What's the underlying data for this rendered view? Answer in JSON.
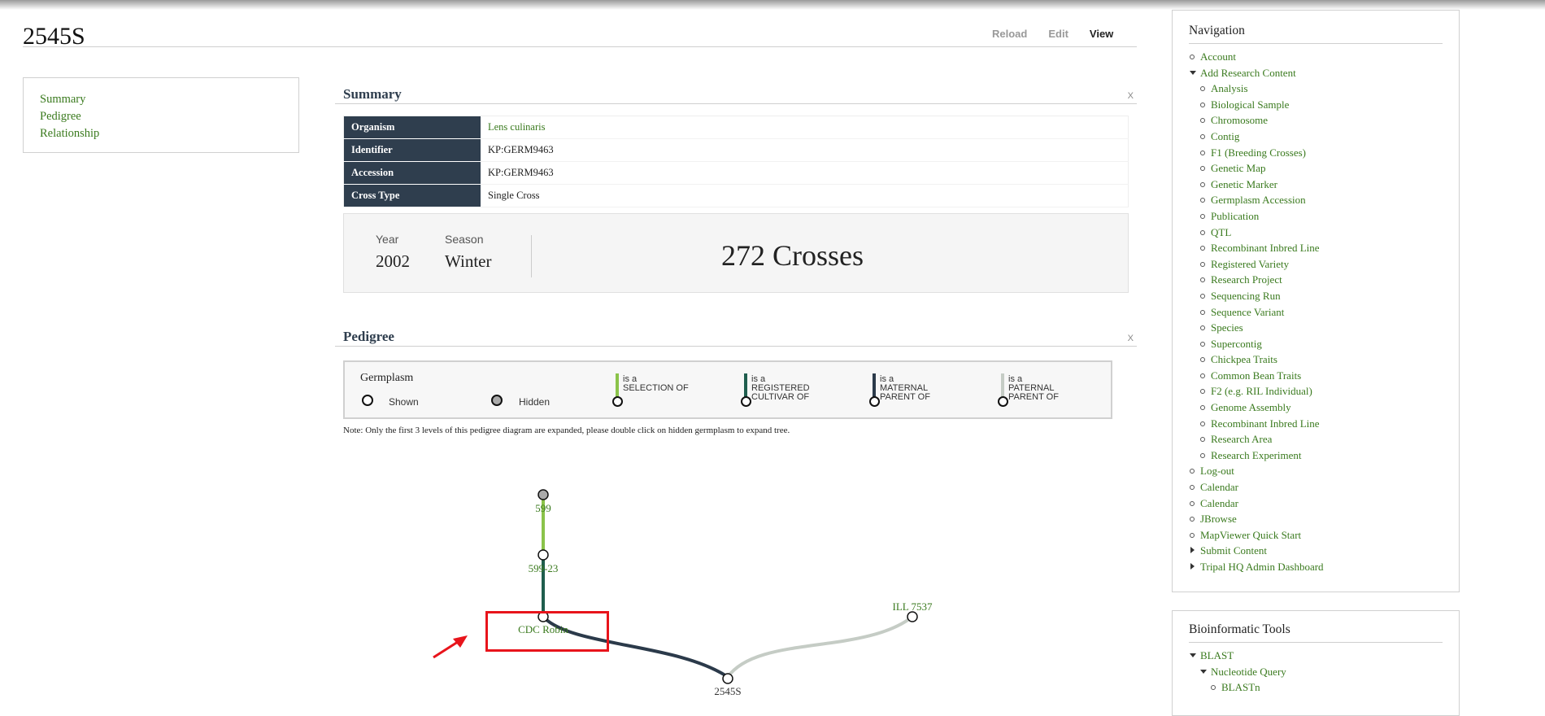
{
  "page": {
    "title": "2545S"
  },
  "tabs": [
    {
      "label": "Reload"
    },
    {
      "label": "Edit"
    },
    {
      "label": "View"
    }
  ],
  "toc": [
    "Summary",
    "Pedigree",
    "Relationship"
  ],
  "summary": {
    "heading": "Summary",
    "close": "X",
    "rows": [
      {
        "key": "Organism",
        "value": "Lens culinaris"
      },
      {
        "key": "Identifier",
        "value": "KP:GERM9463"
      },
      {
        "key": "Accession",
        "value": "KP:GERM9463"
      },
      {
        "key": "Cross Type",
        "value": "Single Cross"
      }
    ],
    "year_label": "Year",
    "year": "2002",
    "season_label": "Season",
    "season": "Winter",
    "crosses": "272 Crosses"
  },
  "pedigree": {
    "heading": "Pedigree",
    "close": "X",
    "legend_title": "Germplasm",
    "shown": "Shown",
    "hidden": "Hidden",
    "relations": [
      {
        "is": "is a",
        "text": [
          "SELECTION OF"
        ],
        "color": "#8bc34a"
      },
      {
        "is": "is a",
        "text": [
          "REGISTERED",
          "CULTIVAR OF"
        ],
        "color": "#1f5e4e"
      },
      {
        "is": "is a",
        "text": [
          "MATERNAL",
          "PARENT OF"
        ],
        "color": "#2b3a4a"
      },
      {
        "is": "is a",
        "text": [
          "PATERNAL",
          "PARENT OF"
        ],
        "color": "#c5ccc5"
      }
    ],
    "note": "Note: Only the first 3 levels of this pedigree diagram are expanded, please double click on hidden germplasm to expand tree.",
    "nodes": {
      "n599": "599",
      "n59923": "599-23",
      "cdc": "CDC Robin",
      "ill": "ILL 7537",
      "root": "2545S"
    }
  },
  "navigation": {
    "title": "Navigation",
    "items": [
      {
        "label": "Account",
        "level": 0,
        "marker": "bullet"
      },
      {
        "label": "Add Research Content",
        "level": 0,
        "marker": "down"
      },
      {
        "label": "Analysis",
        "level": 1,
        "marker": "bullet"
      },
      {
        "label": "Biological Sample",
        "level": 1,
        "marker": "bullet"
      },
      {
        "label": "Chromosome",
        "level": 1,
        "marker": "bullet"
      },
      {
        "label": "Contig",
        "level": 1,
        "marker": "bullet"
      },
      {
        "label": "F1 (Breeding Crosses)",
        "level": 1,
        "marker": "bullet"
      },
      {
        "label": "Genetic Map",
        "level": 1,
        "marker": "bullet"
      },
      {
        "label": "Genetic Marker",
        "level": 1,
        "marker": "bullet"
      },
      {
        "label": "Germplasm Accession",
        "level": 1,
        "marker": "bullet"
      },
      {
        "label": "Publication",
        "level": 1,
        "marker": "bullet"
      },
      {
        "label": "QTL",
        "level": 1,
        "marker": "bullet"
      },
      {
        "label": "Recombinant Inbred Line",
        "level": 1,
        "marker": "bullet"
      },
      {
        "label": "Registered Variety",
        "level": 1,
        "marker": "bullet"
      },
      {
        "label": "Research Project",
        "level": 1,
        "marker": "bullet"
      },
      {
        "label": "Sequencing Run",
        "level": 1,
        "marker": "bullet"
      },
      {
        "label": "Sequence Variant",
        "level": 1,
        "marker": "bullet"
      },
      {
        "label": "Species",
        "level": 1,
        "marker": "bullet"
      },
      {
        "label": "Supercontig",
        "level": 1,
        "marker": "bullet"
      },
      {
        "label": "Chickpea Traits",
        "level": 1,
        "marker": "bullet"
      },
      {
        "label": "Common Bean Traits",
        "level": 1,
        "marker": "bullet"
      },
      {
        "label": "F2 (e.g. RIL Individual)",
        "level": 1,
        "marker": "bullet"
      },
      {
        "label": "Genome Assembly",
        "level": 1,
        "marker": "bullet"
      },
      {
        "label": "Recombinant Inbred Line",
        "level": 1,
        "marker": "bullet"
      },
      {
        "label": "Research Area",
        "level": 1,
        "marker": "bullet"
      },
      {
        "label": "Research Experiment",
        "level": 1,
        "marker": "bullet"
      },
      {
        "label": "Log-out",
        "level": 0,
        "marker": "bullet"
      },
      {
        "label": "Calendar",
        "level": 0,
        "marker": "bullet"
      },
      {
        "label": "Calendar",
        "level": 0,
        "marker": "bullet"
      },
      {
        "label": "JBrowse",
        "level": 0,
        "marker": "bullet"
      },
      {
        "label": "MapViewer Quick Start",
        "level": 0,
        "marker": "bullet"
      },
      {
        "label": "Submit Content",
        "level": 0,
        "marker": "right"
      },
      {
        "label": "Tripal HQ Admin Dashboard",
        "level": 0,
        "marker": "right"
      }
    ]
  },
  "bioinformatics": {
    "title": "Bioinformatic Tools",
    "items": [
      {
        "label": "BLAST",
        "level": 0,
        "marker": "down"
      },
      {
        "label": "Nucleotide Query",
        "level": 1,
        "marker": "down"
      },
      {
        "label": "BLASTn",
        "level": 2,
        "marker": "bullet"
      }
    ]
  },
  "colors": {
    "accent": "#3a7a1e",
    "header_dark": "#2f3e4e",
    "highlight": "#e8141b"
  }
}
